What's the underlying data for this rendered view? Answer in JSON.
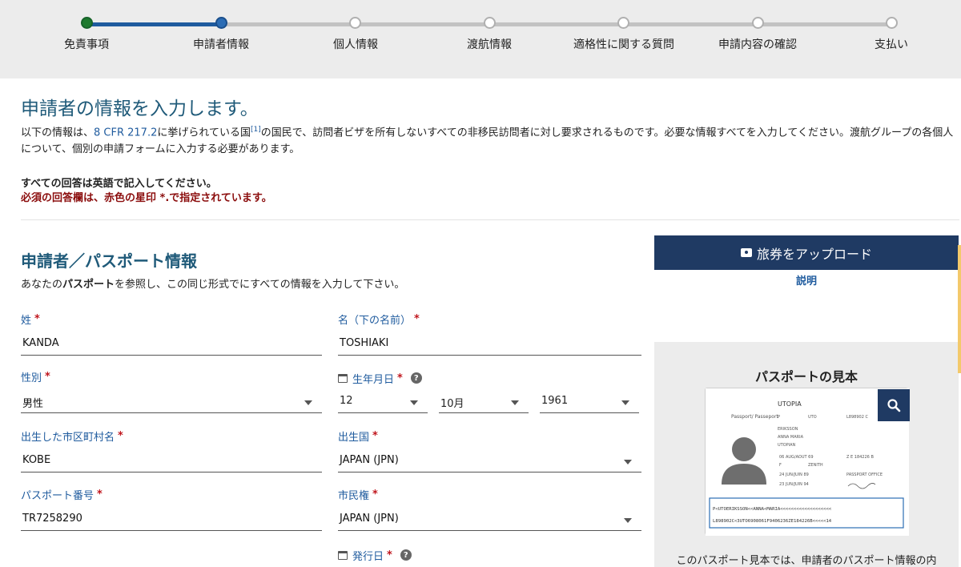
{
  "progress": {
    "steps": [
      {
        "label": "免責事項",
        "state": "done"
      },
      {
        "label": "申請者情報",
        "state": "active"
      },
      {
        "label": "個人情報",
        "state": "todo"
      },
      {
        "label": "渡航情報",
        "state": "todo"
      },
      {
        "label": "適格性に関する質問",
        "state": "todo"
      },
      {
        "label": "申請内容の確認",
        "state": "todo"
      },
      {
        "label": "支払い",
        "state": "todo"
      }
    ]
  },
  "intro": {
    "title": "申請者の情報を入力します。",
    "text_before_link": "以下の情報は、",
    "link_text": "8 CFR 217.2",
    "text_after_link": "に挙げられている国",
    "footnote": "[1]",
    "text_rest": "の国民で、訪問者ビザを所有しないすべての非移民訪問者に対し要求されるものです。必要な情報すべてを入力してください。渡航グループの各個人について、個別の申請フォームに入力する必要があります。",
    "note_english": "すべての回答は英語で記入してください。",
    "note_required": "必須の回答欄は、赤色の星印 *.で指定されています。"
  },
  "section": {
    "title": "申請者／パスポート情報",
    "desc_before": "あなたの",
    "desc_bold": "パスポート",
    "desc_after": "を参照し、この同じ形式でにすべての情報を入力して下さい。"
  },
  "fields": {
    "surname": {
      "label": "姓",
      "value": "KANDA"
    },
    "given_name": {
      "label": "名（下の名前）",
      "value": "TOSHIAKI"
    },
    "gender": {
      "label": "性別",
      "value": "男性"
    },
    "birth_date": {
      "label": "生年月日",
      "day": "12",
      "month": "10月",
      "year": "1961"
    },
    "birth_city": {
      "label": "出生した市区町村名",
      "value": "KOBE"
    },
    "birth_country": {
      "label": "出生国",
      "value": "JAPAN (JPN)"
    },
    "passport_number": {
      "label": "パスポート番号",
      "value": "TR7258290"
    },
    "citizenship": {
      "label": "市民権",
      "value": "JAPAN (JPN)"
    },
    "issue_date": {
      "label": "発行日"
    }
  },
  "required_mark": "*",
  "help_mark": "?",
  "sidebar": {
    "upload_label": "旅券をアップロード",
    "explain_label": "説明",
    "sample_title": "パスポートの見本",
    "sample_text": "このパスポート見本では、申請者のパスポート情報の内",
    "passport": {
      "country": "UTOPIA",
      "type_label": "Passport/ Passeport",
      "type": "P",
      "code": "UTO",
      "number": "L898902 C",
      "surname": "ERIKSSON",
      "given": "ANNA MARIA",
      "nationality": "UTOPIAN",
      "dob": "06 AUG/AOUT 69",
      "personal_no": "Z E 184226 B",
      "sex": "F",
      "place_of_birth": "ZENITH",
      "issue": "24 JUN/JUIN 89",
      "authority": "PASSPORT OFFICE",
      "expiry": "23 JUN/JUIN 94",
      "mrz1": "P<UTOERIKSSON<<ANNA<MARIA<<<<<<<<<<<<<<<<<<<",
      "mrz2": "L898902C<3UTO6908061F9406236ZE184226B<<<<<14"
    }
  },
  "colors": {
    "accent": "#1f5b9e",
    "title": "#1f5a79",
    "button": "#1f3a63",
    "required": "#c0161d",
    "done_step": "#1e7a2e"
  }
}
